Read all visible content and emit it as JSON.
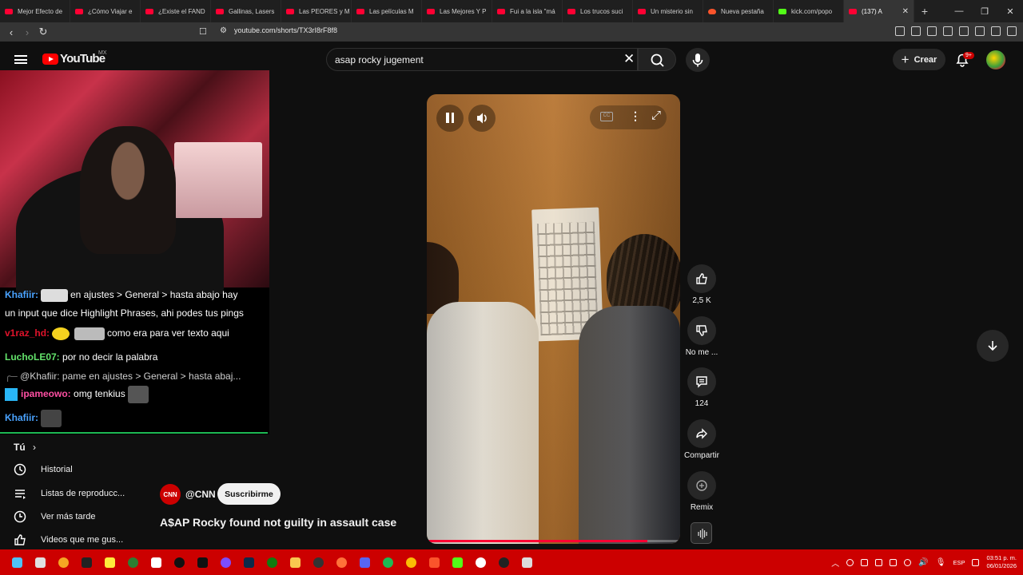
{
  "browser": {
    "tabs": [
      {
        "label": "Mejor Efecto de",
        "icon": "youtube-icon"
      },
      {
        "label": "¿Cómo Viajar e",
        "icon": "youtube-icon"
      },
      {
        "label": "¿Existe el FAND",
        "icon": "youtube-icon"
      },
      {
        "label": "Gallinas, Lasers",
        "icon": "youtube-icon"
      },
      {
        "label": "Las PEORES y M",
        "icon": "youtube-icon"
      },
      {
        "label": "Las películas M",
        "icon": "youtube-icon"
      },
      {
        "label": "Las Mejores Y P",
        "icon": "youtube-icon"
      },
      {
        "label": "Fui a la isla \"má",
        "icon": "youtube-icon"
      },
      {
        "label": "Los trucos suci",
        "icon": "youtube-icon"
      },
      {
        "label": "Un misterio sin",
        "icon": "youtube-icon"
      },
      {
        "label": "Nueva pestaña",
        "icon": "brave-icon"
      },
      {
        "label": "kick.com/popo",
        "icon": "kick-icon"
      },
      {
        "label": "(137) A",
        "icon": "youtube-icon",
        "active": true
      }
    ],
    "url": "youtube.com/shorts/TX3rI8rF8f8"
  },
  "youtube": {
    "logo_text": "YouTube",
    "country": "MX",
    "search_value": "asap rocky jugement",
    "create_label": "Crear",
    "notifications_badge": "9+"
  },
  "chat": {
    "messages": [
      {
        "user": "Khafiir:",
        "text": "en ajustes > General > hasta abajo hay"
      },
      {
        "user": "",
        "text": "un input que dice Highlight Phrases, ahi podes tus pings"
      },
      {
        "user": "v1raz_hd:",
        "text": "como era para ver texto aqui"
      },
      {
        "user": "LuchoLE07:",
        "text": "por no decir la palabra"
      },
      {
        "user": "",
        "text": "@Khafiir: pame en ajustes > General > hasta abaj..."
      },
      {
        "user": "ipameowo:",
        "text": "omg tenkius"
      },
      {
        "user": "Khafiir:",
        "text": ""
      }
    ]
  },
  "sidebar": {
    "section_title": "Tú",
    "items": [
      {
        "label": "Historial",
        "icon": "history-icon"
      },
      {
        "label": "Listas de reproducc...",
        "icon": "playlist-icon"
      },
      {
        "label": "Ver más tarde",
        "icon": "clock-icon"
      },
      {
        "label": "Videos que me gus...",
        "icon": "thumbs-up-icon"
      }
    ]
  },
  "short": {
    "channel_logo": "CNN",
    "channel_handle": "@CNN",
    "subscribe_label": "Suscribirme",
    "title": "A$AP Rocky found not guilty in assault case",
    "progress": 0.87,
    "actions": {
      "like_count": "2,5 K",
      "dislike_label": "No me ...",
      "comments_count": "124",
      "share_label": "Compartir",
      "remix_label": "Remix"
    }
  },
  "taskbar": {
    "language": "ESP",
    "time": "03:51 p. m.",
    "date": "06/01/2026"
  },
  "colors": {
    "youtube_red": "#ff0000",
    "taskbar": "#cc0000",
    "background": "#0f0f0f"
  }
}
